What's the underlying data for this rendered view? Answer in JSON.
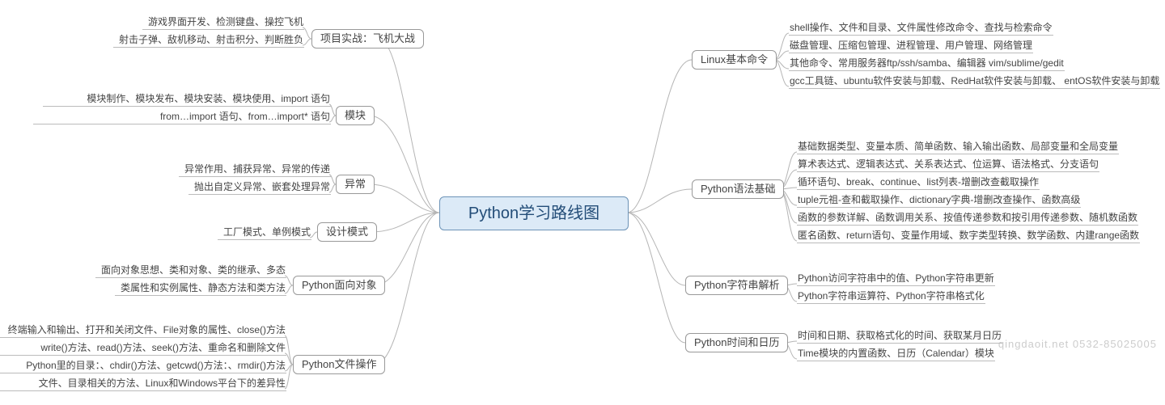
{
  "center": "Python学习路线图",
  "watermark": "qingdaoit.net 0532-85025005",
  "left_branches": [
    {
      "name": "项目实战：飞机大战",
      "leaves": [
        "游戏界面开发、检测键盘、操控飞机",
        "射击子弹、敌机移动、射击积分、判断胜负"
      ]
    },
    {
      "name": "模块",
      "leaves": [
        "模块制作、模块发布、模块安装、模块使用、import 语句",
        "from…import 语句、from…import* 语句"
      ]
    },
    {
      "name": "异常",
      "leaves": [
        "异常作用、捕获异常、异常的传递",
        "抛出自定义异常、嵌套处理异常"
      ]
    },
    {
      "name": "设计模式",
      "leaves": [
        "工厂模式、单例模式"
      ]
    },
    {
      "name": "Python面向对象",
      "leaves": [
        "面向对象思想、类和对象、类的继承、多态",
        "类属性和实例属性、静态方法和类方法"
      ]
    },
    {
      "name": "Python文件操作",
      "leaves": [
        "终端输入和输出、打开和关闭文件、File对象的属性、close()方法",
        "write()方法、read()方法、seek()方法、重命名和删除文件",
        "Python里的目录：、chdir()方法、getcwd()方法：、rmdir()方法",
        "文件、目录相关的方法、Linux和Windows平台下的差异性"
      ]
    }
  ],
  "right_branches": [
    {
      "name": "Linux基本命令",
      "leaves": [
        "shell操作、文件和目录、文件属性修改命令、查找与检索命令",
        "磁盘管理、压缩包管理、进程管理、用户管理、网络管理",
        "其他命令、常用服务器ftp/ssh/samba、编辑器 vim/sublime/gedit",
        "gcc工具链、ubuntu软件安装与卸载、RedHat软件安装与卸载、 entOS软件安装与卸载"
      ]
    },
    {
      "name": "Python语法基础",
      "leaves": [
        "基础数据类型、变量本质、简单函数、输入输出函数、局部变量和全局变量",
        "算术表达式、逻辑表达式、关系表达式、位运算、语法格式、分支语句",
        "循环语句、break、continue、list列表-增删改查截取操作",
        "tuple元祖-查和截取操作、dictionary字典-增删改查操作、函数高级",
        "函数的参数详解、函数调用关系、按值传递参数和按引用传递参数、随机数函数",
        "匿名函数、return语句、变量作用域、数字类型转换、数学函数、内建range函数"
      ]
    },
    {
      "name": "Python字符串解析",
      "leaves": [
        "Python访问字符串中的值、Python字符串更新",
        "Python字符串运算符、Python字符串格式化"
      ]
    },
    {
      "name": "Python时间和日历",
      "leaves": [
        "时间和日期、获取格式化的时间、获取某月日历",
        "Time模块的内置函数、日历（Calendar）模块"
      ]
    }
  ]
}
